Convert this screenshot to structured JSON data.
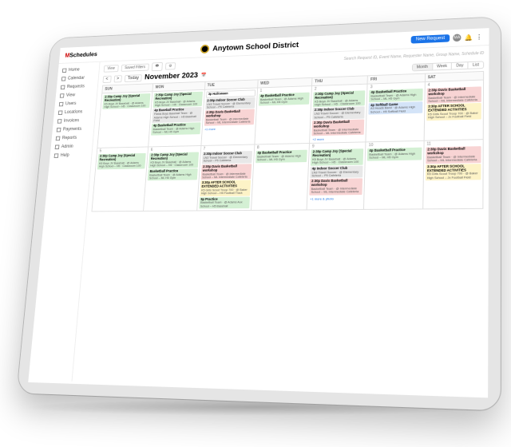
{
  "brand": {
    "prefix": "M",
    "name": "Schedules"
  },
  "header": {
    "title": "Anytown School District"
  },
  "top": {
    "new_request": "New Request",
    "avatar": "MA"
  },
  "sidebar": {
    "items": [
      {
        "label": "Home"
      },
      {
        "label": "Calendar"
      },
      {
        "label": "Requests"
      },
      {
        "label": "View"
      },
      {
        "label": "Users"
      },
      {
        "label": "Locations"
      },
      {
        "label": "Invoices"
      },
      {
        "label": "Payments"
      },
      {
        "label": "Reports"
      },
      {
        "label": "Admin"
      },
      {
        "label": "Help"
      }
    ]
  },
  "filters": {
    "view": "View",
    "saved": "Saved Filters",
    "icon1": "print",
    "icon2": "settings",
    "search_ph": "Search Request ID, Event Name, Requester Name, Group Name, Schedule ID"
  },
  "cal": {
    "prev": "<",
    "next": ">",
    "today": "Today",
    "month": "November 2023",
    "views": [
      "Month",
      "Week",
      "Day",
      "List"
    ],
    "active": "Month"
  },
  "dayheaders": [
    "SUN",
    "MON",
    "TUE",
    "WED",
    "THU",
    "FRI",
    "SAT"
  ],
  "weeks": [
    [
      {
        "n": "",
        "ev": [
          {
            "c": "green",
            "t": "2:30p Camp Joy (Special Recreation)",
            "d": "K5 Boys JV Baseball · @ Adams High School – H5 · Classroom 100"
          }
        ]
      },
      {
        "n": "",
        "ev": [
          {
            "c": "green",
            "t": "2:30p Camp Joy (Special Recreation)",
            "d": "K5 Boys JV Baseball · @ Adams High School – H5 · Classroom 100"
          },
          {
            "c": "gray",
            "t": "4p Baseball Practice",
            "d": "Fields Boys Baseball Team · @ Adams High School – H5 Baseball Field"
          },
          {
            "c": "green",
            "t": "4p Basketball Practice",
            "d": "Basketball Team · @ Adams High School – ML H5 Gym"
          }
        ]
      },
      {
        "n": "",
        "ev": [
          {
            "c": "white",
            "t": "3p Halloween",
            "d": ""
          },
          {
            "c": "gray",
            "t": "2:30p Indoor Soccer Club",
            "d": "LN3 Travel Soccer · @ Elementary School – P5 Cafeteria"
          },
          {
            "c": "pink",
            "t": "2:30p Davis Basketball workshop",
            "d": "Basketball Team · @ Intermediate School – ML Intermediate Cafeteria"
          }
        ],
        "more": "+1 more"
      },
      {
        "n": "1",
        "ev": [
          {
            "c": "green",
            "t": "4p Basketball Practice",
            "d": "Basketball Team · @ Adams High School – ML H5 Gym"
          }
        ]
      },
      {
        "n": "2",
        "ev": [
          {
            "c": "green",
            "t": "2:30p Camp Joy (Special Recreation)",
            "d": "K5 Boys JV Baseball · @ Adams High School – H5 · Classroom 100"
          },
          {
            "c": "gray",
            "t": "2:30p Indoor Soccer Club",
            "d": "LN3 Travel Soccer · @ Elementary School – P5 Cafeteria"
          },
          {
            "c": "pink",
            "t": "2:30p Davis Basketball workshop",
            "d": "Basketball Team · @ Intermediate School – ML Intermediate Cafeteria"
          }
        ],
        "more": "+2 more"
      },
      {
        "n": "3",
        "ev": [
          {
            "c": "green",
            "t": "4p Basketball Practice",
            "d": "Basketball Team · @ Adams High School – ML H5 Gym"
          },
          {
            "c": "blue",
            "t": "4p Softball Game",
            "d": "A3 Heads Band · @ Adams High School – H5 Softball Field"
          }
        ]
      },
      {
        "n": "4",
        "ev": [
          {
            "c": "pink",
            "t": "2:30p Davis Basketball workshop",
            "d": "Basketball Team · @ Intermediate School – ML Intermediate Cafeteria"
          },
          {
            "c": "yellow",
            "t": "3:30p AFTER SCHOOL EXTENDED ACTIVITIES",
            "d": "K5 Girls Scout Troop 700 · @ Baker High School – Jx Football Field"
          }
        ]
      }
    ],
    [
      {
        "n": "5",
        "ev": [
          {
            "c": "green",
            "t": "2:30p Camp Joy (Special Recreation)",
            "d": "K5 Boys JV Baseball · @ Adams High School – H5 · Classroom 100"
          }
        ]
      },
      {
        "n": "6",
        "ev": [
          {
            "c": "green",
            "t": "2:30p Camp Joy (Special Recreation)",
            "d": "K5 Boys JV Baseball · @ Adams High School – H5 · Classroom 100"
          },
          {
            "c": "green",
            "t": "Basketball Practice",
            "d": "Basketball Team · @ Adams High School – ML H5 Gym"
          }
        ]
      },
      {
        "n": "7",
        "ev": [
          {
            "c": "gray",
            "t": "2:30p Indoor Soccer Club",
            "d": "LN3 Travel Soccer · @ Elementary School – P5 Cafeteria"
          },
          {
            "c": "pink",
            "t": "2:30p Davis Basketball workshop",
            "d": "Basketball Team · @ Intermediate School – ML Intermediate Cafeteria"
          },
          {
            "c": "yellow",
            "t": "3:30p AFTER SCHOOL EXTENDED ACTIVITIES",
            "d": "K5 Girls Scout Troop 700 · @ Baker High School – H5 Football Track"
          },
          {
            "c": "green",
            "t": "5p Practice",
            "d": "Basketball Team · @ Adams Aux School – H5 Baseball"
          }
        ]
      },
      {
        "n": "8",
        "ev": [
          {
            "c": "green",
            "t": "4p Basketball Practice",
            "d": "Basketball Team · @ Adams High School – ML H5 Gym"
          }
        ]
      },
      {
        "n": "9",
        "ev": [
          {
            "c": "green",
            "t": "2:30p Camp Joy (Special Recreation)",
            "d": "K5 Boys JV Baseball · @ Adams High School – H5 · Classroom 100"
          },
          {
            "c": "gray",
            "t": "4p Indoor Soccer Club",
            "d": "LN3 Travel Soccer · @ Elementary School – P5 Cafeteria"
          },
          {
            "c": "pink",
            "t": "2:30p Davis Basketball workshop",
            "d": "Basketball Team · @ Intermediate School – ML Intermediate Cafeteria"
          }
        ],
        "more": "+1 more & photo"
      },
      {
        "n": "10",
        "ev": [
          {
            "c": "green",
            "t": "4p Basketball Practice",
            "d": "Basketball Team · @ Adams High School – ML H5 Gym"
          }
        ]
      },
      {
        "n": "11",
        "ev": [
          {
            "c": "pink",
            "t": "2:30p Davis Basketball workshop",
            "d": "Basketball Team · @ Intermediate School – ML Intermediate Cafeteria"
          },
          {
            "c": "yellow",
            "t": "3:30p AFTER SCHOOL EXTENDED ACTIVITIES",
            "d": "K5 Girls Scout Troop 700 · @ Baker High School – Jx Football Field"
          }
        ]
      }
    ]
  ]
}
